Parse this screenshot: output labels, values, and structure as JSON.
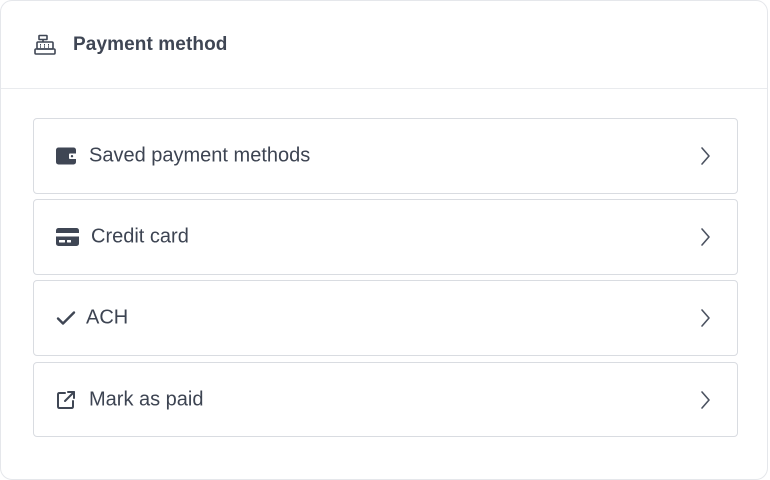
{
  "header": {
    "title": "Payment method",
    "icon": "cash-register-icon"
  },
  "options": [
    {
      "label": "Saved payment methods",
      "icon": "wallet-icon"
    },
    {
      "label": "Credit card",
      "icon": "credit-card-icon"
    },
    {
      "label": "ACH",
      "icon": "check-icon"
    },
    {
      "label": "Mark as paid",
      "icon": "external-link-icon"
    }
  ],
  "colors": {
    "text": "#3d4452",
    "border": "#d9dce1",
    "icon": "#3f4654"
  }
}
